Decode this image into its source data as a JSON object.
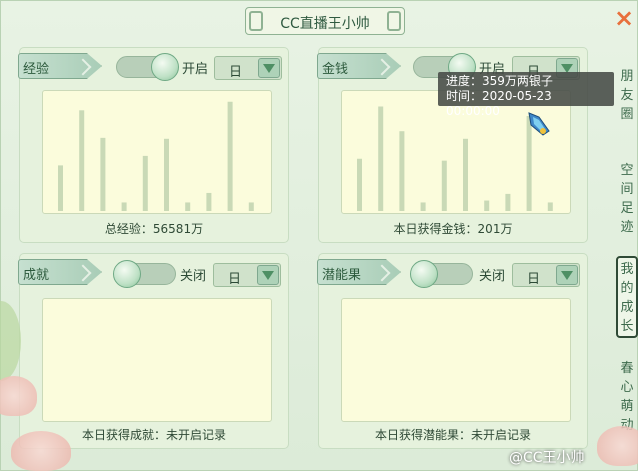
{
  "title": "CC直播王小帅",
  "close": "×",
  "panels": [
    {
      "tag": "经验",
      "state": "开启",
      "on": true,
      "select": "日",
      "footer": "总经验：56581万",
      "chart_data": {
        "type": "bar",
        "values": [
          48,
          106,
          77,
          9,
          58,
          76,
          9,
          19,
          115,
          9
        ]
      }
    },
    {
      "tag": "金钱",
      "state": "开启",
      "on": true,
      "select": "日",
      "footer": "本日获得金钱：201万",
      "chart_data": {
        "type": "bar",
        "values": [
          55,
          110,
          84,
          9,
          53,
          76,
          11,
          18,
          100,
          9
        ]
      }
    },
    {
      "tag": "成就",
      "state": "关闭",
      "on": false,
      "select": "日",
      "footer": "本日获得成就：未开启记录"
    },
    {
      "tag": "潜能果",
      "state": "关闭",
      "on": false,
      "select": "日",
      "footer": "本日获得潜能果：未开启记录"
    }
  ],
  "tooltip": {
    "line1": "进度：359万两银子",
    "line2": "时间：2020-05-23 00:00:00"
  },
  "side_tabs": [
    {
      "label": "朋友圈",
      "active": false
    },
    {
      "label": "空间足迹",
      "active": false
    },
    {
      "label": "我的成长",
      "active": true
    },
    {
      "label": "春心萌动",
      "active": false
    }
  ],
  "watermark": "@CC王小帅",
  "colors": {
    "bar": "#c9d9b6",
    "chart_bg": "#fbfcdc",
    "accent": "#e8703c"
  }
}
